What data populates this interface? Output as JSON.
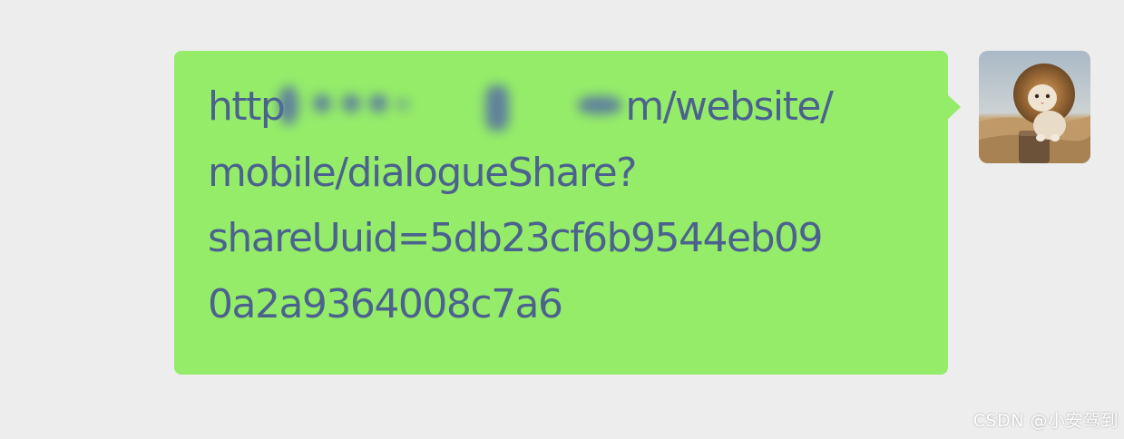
{
  "message": {
    "url_prefix": "http",
    "url_after_redaction": "m/website/",
    "line2": "mobile/dialogueShare?",
    "line3": "shareUuid=5db23cf6b9544eb09",
    "line4": "0a2a9364008c7a6"
  },
  "avatar": {
    "icon": "lion-cat-photo"
  },
  "watermark": {
    "text": "CSDN @小安驾到"
  },
  "colors": {
    "background": "#ededed",
    "bubble": "#95ec69",
    "text": "#4b628e",
    "watermark": "#ffffff"
  }
}
